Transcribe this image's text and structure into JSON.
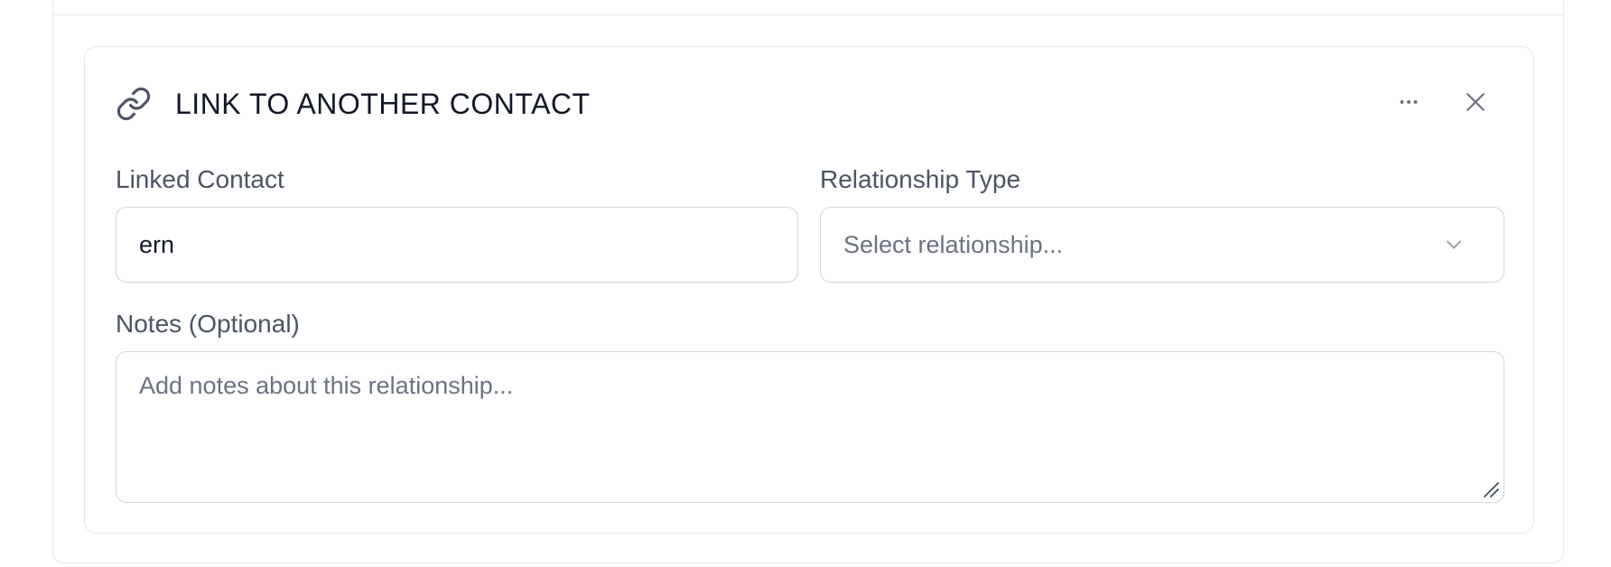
{
  "card": {
    "title": "LINK TO ANOTHER CONTACT",
    "icons": {
      "title": "link-icon",
      "more": "more-horizontal-icon",
      "close": "close-icon"
    }
  },
  "form": {
    "linked_contact": {
      "label": "Linked Contact",
      "value": "ern"
    },
    "relationship_type": {
      "label": "Relationship Type",
      "placeholder": "Select relationship...",
      "icon": "chevron-down-icon"
    },
    "notes": {
      "label": "Notes (Optional)",
      "placeholder": "Add notes about this relationship..."
    }
  },
  "colors": {
    "border": "#e5e7eb",
    "input_border": "#d1d5db",
    "title_text": "#111827",
    "label_text": "#4b5563",
    "placeholder_text": "#6b7280"
  }
}
